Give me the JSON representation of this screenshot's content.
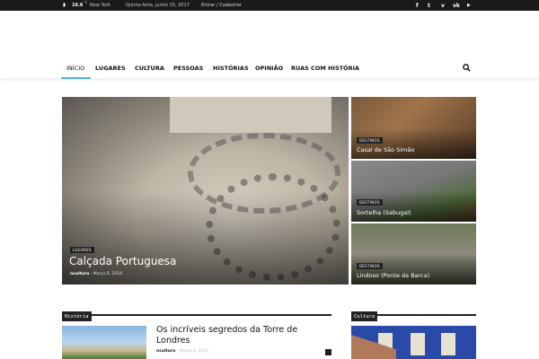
{
  "topbar": {
    "temp": "16.6",
    "unit": "°C",
    "city": "New York",
    "date": "Quinta-feira, junho 15, 2017",
    "login": "Entrar / Cadastrar",
    "social": [
      {
        "icon": "facebook-icon",
        "glyph": "f"
      },
      {
        "icon": "twitter-icon",
        "glyph": "t"
      },
      {
        "icon": "vimeo-icon",
        "glyph": "v"
      },
      {
        "icon": "vk-icon",
        "glyph": "vk"
      },
      {
        "icon": "youtube-icon",
        "glyph": "▶"
      }
    ]
  },
  "nav": {
    "items": [
      "INÍCIO",
      "LUGARES",
      "CULTURA",
      "PESSOAS",
      "HISTÓRIAS",
      "OPINIÃO",
      "RUAS COM HISTÓRIA"
    ],
    "accent": "#4db2ec"
  },
  "featured": {
    "category": "LUGARES",
    "title": "Calçada Portuguesa",
    "author": "ncultura",
    "date": "Março 8, 2016"
  },
  "side": [
    {
      "category": "DESTINOS",
      "title": "Casal de São Simão"
    },
    {
      "category": "DESTINOS",
      "title": "Sortelha (Sabugal)"
    },
    {
      "category": "DESTINOS",
      "title": "Lindoso (Ponte da Barca)"
    }
  ],
  "sections": {
    "historia": "História",
    "cultura": "Cultura"
  },
  "article": {
    "title": "Os incríveis segredos da Torre de Londres",
    "author": "ncultura",
    "date": "Março 8, 2016"
  }
}
